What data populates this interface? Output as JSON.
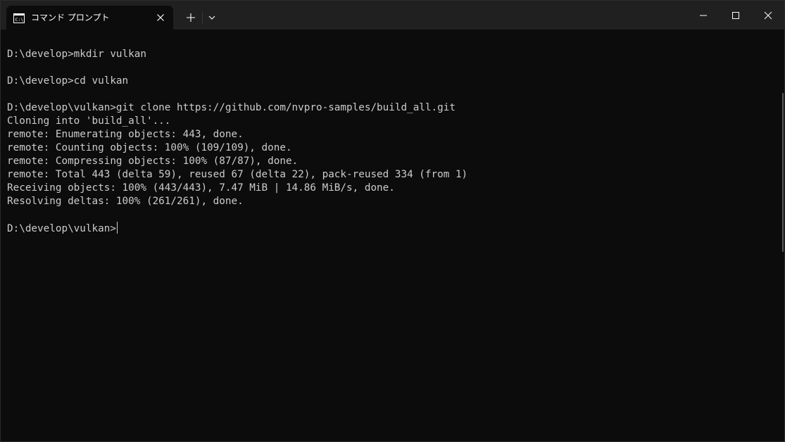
{
  "window": {
    "tab_title": "コマンド プロンプト",
    "icons": {
      "tab_icon": "cmd-icon",
      "close": "close-icon",
      "new_tab": "plus-icon",
      "dropdown": "chevron-down-icon",
      "minimize": "minimize-icon",
      "maximize": "maximize-icon",
      "window_close": "close-icon"
    },
    "colors": {
      "titlebar": "#202020",
      "terminal_bg": "#0c0c0c",
      "text": "#cccccc"
    }
  },
  "terminal": {
    "lines": [
      "",
      "D:\\develop>mkdir vulkan",
      "",
      "D:\\develop>cd vulkan",
      "",
      "D:\\develop\\vulkan>git clone https://github.com/nvpro-samples/build_all.git",
      "Cloning into 'build_all'...",
      "remote: Enumerating objects: 443, done.",
      "remote: Counting objects: 100% (109/109), done.",
      "remote: Compressing objects: 100% (87/87), done.",
      "remote: Total 443 (delta 59), reused 67 (delta 22), pack-reused 334 (from 1)",
      "Receiving objects: 100% (443/443), 7.47 MiB | 14.86 MiB/s, done.",
      "Resolving deltas: 100% (261/261), done.",
      "",
      "D:\\develop\\vulkan>"
    ]
  }
}
